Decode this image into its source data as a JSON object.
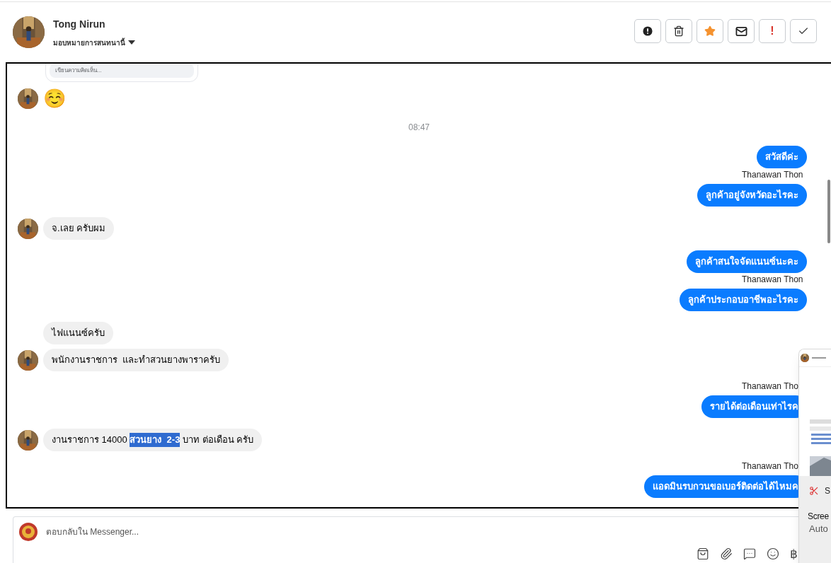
{
  "header": {
    "name": "Tong Nirun",
    "assign_label": "มอบหมายการสนทนานี้"
  },
  "actions": [
    {
      "kind": "alert"
    },
    {
      "kind": "trash"
    },
    {
      "kind": "star"
    },
    {
      "kind": "mail"
    },
    {
      "kind": "text",
      "text": "!"
    },
    {
      "kind": "check"
    }
  ],
  "comment_field": {
    "placeholder": "เขียนความคิดเห็น..."
  },
  "messages": [
    {
      "kind": "emoji",
      "avatar": true,
      "text": "☺️"
    },
    {
      "kind": "time",
      "text": "08:47"
    },
    {
      "kind": "outgoing",
      "text": "สวัสดีค่ะ"
    },
    {
      "kind": "sender",
      "text": "Thanawan Thon"
    },
    {
      "kind": "outgoing",
      "text": "ลูกค้าอยู่จังหวัดอะไรคะ"
    },
    {
      "kind": "incoming",
      "avatar": true,
      "text": "จ.เลย ครับผม"
    },
    {
      "kind": "outgoing",
      "text": "ลูกค้าสนใจจัดแนนซ์นะคะ"
    },
    {
      "kind": "sender",
      "text": "Thanawan Thon"
    },
    {
      "kind": "outgoing",
      "text": "ลูกค้าประกอบอาชีพอะไรคะ"
    },
    {
      "kind": "incoming",
      "avatar": false,
      "text": "ไฟแนนซ์ครับ"
    },
    {
      "kind": "incoming",
      "avatar": true,
      "text": "พนักงานราชการ  และทำสวนยางพาราครับ"
    },
    {
      "kind": "sender",
      "text": "Thanawan Tho"
    },
    {
      "kind": "outgoing",
      "text": "รายได้ต่อเดือนเท่าไรค"
    },
    {
      "kind": "incoming",
      "avatar": true,
      "parts": [
        {
          "text": "งานราชการ 14000 ",
          "selected": false
        },
        {
          "text": "สวนยาง  2-3",
          "selected": true
        },
        {
          "text": " บาท ต่อเดือน ครับ",
          "selected": false
        }
      ]
    },
    {
      "kind": "sender",
      "text": "Thanawan Tho"
    },
    {
      "kind": "outgoing",
      "text": "แอดมินรบกวนขอเบอร์ติดต่อได้ไหมค"
    }
  ],
  "composer": {
    "placeholder": "ตอบกลับใน Messenger...",
    "tools": [
      {
        "kind": "bag"
      },
      {
        "kind": "clip"
      },
      {
        "kind": "chat"
      },
      {
        "kind": "smile"
      },
      {
        "kind": "text",
        "text": "฿"
      }
    ]
  },
  "notification": {
    "app": "S",
    "title": "Scree",
    "subtitle": "Auto"
  }
}
